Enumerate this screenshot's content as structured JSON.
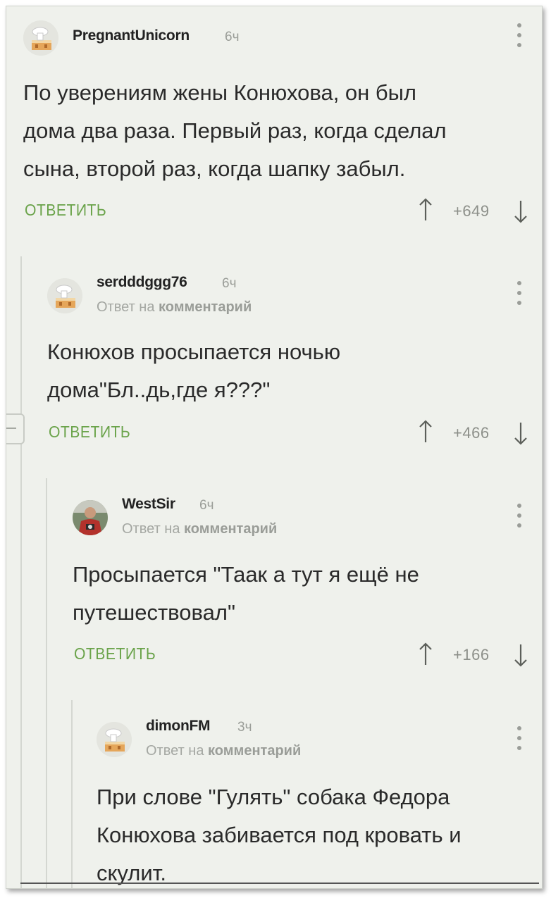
{
  "action_labels": {
    "reply": "ОТВЕТИТЬ",
    "reply_to_prefix": "Ответ на",
    "reply_to_target": "комментарий"
  },
  "comments": [
    {
      "username": "PregnantUnicorn",
      "time": "6ч",
      "text_lines": [
        "По уверениям жены Конюхова, он был",
        "дома два раза. Первый раз, когда сделал",
        "сына, второй раз, когда шапку забыл."
      ],
      "score": "+649",
      "avatar": "default-cake-avatar"
    },
    {
      "username": "serdddggg76",
      "time": "6ч",
      "text_lines": [
        "Конюхов просыпается ночью",
        "дома\"Бл..дь,где я???\""
      ],
      "score": "+466",
      "avatar": "default-cake-avatar"
    },
    {
      "username": "WestSir",
      "time": "6ч",
      "text_lines": [
        "Просыпается \"Таак а тут я ещё не",
        "путешествовал\""
      ],
      "score": "+166",
      "avatar": "photo-avatar"
    },
    {
      "username": "dimonFM",
      "time": "3ч",
      "text_lines": [
        "При слове \"Гулять\" собака Федора",
        "Конюхова забивается под кровать и",
        "скулит."
      ],
      "avatar": "default-cake-avatar"
    }
  ],
  "colors": {
    "accent_green": "#6aa34a",
    "background": "#eff1ec",
    "muted": "#9a9d98"
  }
}
